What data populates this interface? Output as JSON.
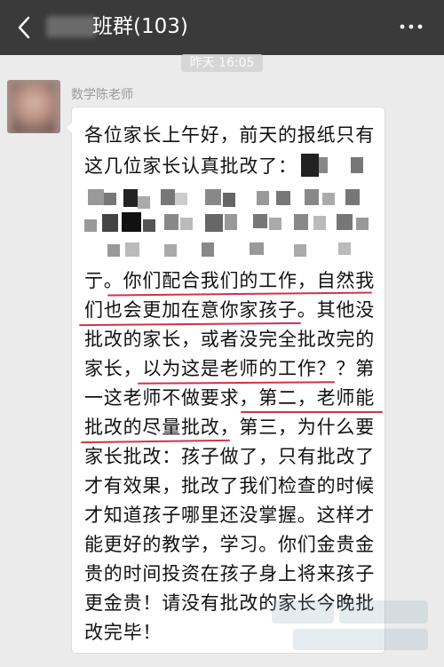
{
  "header": {
    "title": "班群(103)",
    "back_icon": "chevron-left-icon",
    "more_icon": "more-dots-icon"
  },
  "timestamp": "昨天 16:05",
  "message": {
    "sender": "数学陈老师",
    "lines": [
      "各位家长上午好，前天的报纸只有",
      "这几位家长认真批改了：",
      "",
      "",
      "亍。你们配合我们的工作，自然我",
      "们也会更加在意你家孩子。其他没",
      "批改的家长，或者没完全批改完的",
      "家长，以为这是老师的工作？？第",
      "一这老师不做要求，第二，老师能",
      "批改的尽量批改，第三，为什么要",
      "家长批改：孩子做了，只有批改了",
      "才有效果，批改了我们检查的时候",
      "才知道孩子哪里还没掌握。这样才",
      "能更好的教学，学习。你们金贵金",
      "贵的时间投资在孩子身上将来孩子",
      "更金贵！请没有批改的家长今晚批",
      "改完毕！"
    ]
  },
  "colors": {
    "header_bg": "#3a3a3a",
    "chat_bg": "#ebebeb",
    "underline": "#d2324a"
  }
}
